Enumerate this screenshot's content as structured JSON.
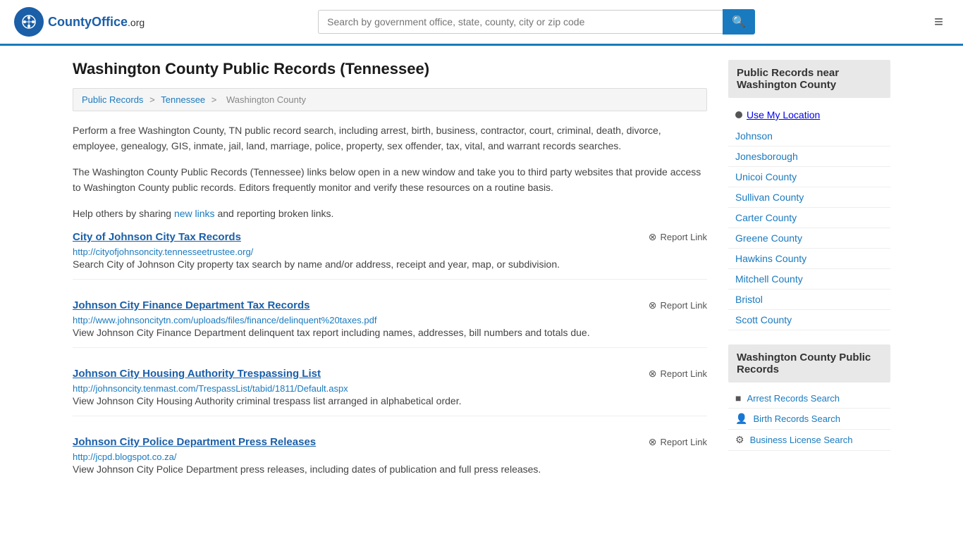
{
  "header": {
    "logo_text": "CountyOffice",
    "logo_suffix": ".org",
    "search_placeholder": "Search by government office, state, county, city or zip code",
    "search_icon": "🔍",
    "menu_icon": "≡"
  },
  "page": {
    "title": "Washington County Public Records (Tennessee)",
    "breadcrumb": {
      "items": [
        "Public Records",
        "Tennessee",
        "Washington County"
      ],
      "separators": [
        ">",
        ">"
      ]
    },
    "description1": "Perform a free Washington County, TN public record search, including arrest, birth, business, contractor, court, criminal, death, divorce, employee, genealogy, GIS, inmate, jail, land, marriage, police, property, sex offender, tax, vital, and warrant records searches.",
    "description2": "The Washington County Public Records (Tennessee) links below open in a new window and take you to third party websites that provide access to Washington County public records. Editors frequently monitor and verify these resources on a routine basis.",
    "description3_prefix": "Help others by sharing ",
    "description3_link": "new links",
    "description3_suffix": " and reporting broken links."
  },
  "records": [
    {
      "title": "City of Johnson City Tax Records",
      "url": "http://cityofjohnsoncity.tennesseetrustee.org/",
      "description": "Search City of Johnson City property tax search by name and/or address, receipt and year, map, or subdivision.",
      "report_label": "Report Link"
    },
    {
      "title": "Johnson City Finance Department Tax Records",
      "url": "http://www.johnsoncitytn.com/uploads/files/finance/delinquent%20taxes.pdf",
      "description": "View Johnson City Finance Department delinquent tax report including names, addresses, bill numbers and totals due.",
      "report_label": "Report Link"
    },
    {
      "title": "Johnson City Housing Authority Trespassing List",
      "url": "http://johnsoncity.tenmast.com/TrespassList/tabid/1811/Default.aspx",
      "description": "View Johnson City Housing Authority criminal trespass list arranged in alphabetical order.",
      "report_label": "Report Link"
    },
    {
      "title": "Johnson City Police Department Press Releases",
      "url": "http://jcpd.blogspot.co.za/",
      "description": "View Johnson City Police Department press releases, including dates of publication and full press releases.",
      "report_label": "Report Link"
    }
  ],
  "sidebar": {
    "nearby_header": "Public Records near Washington County",
    "use_location": "Use My Location",
    "nearby_places": [
      "Johnson",
      "Jonesborough",
      "Unicoi County",
      "Sullivan County",
      "Carter County",
      "Greene County",
      "Hawkins County",
      "Mitchell County",
      "Bristol",
      "Scott County"
    ],
    "records_header": "Washington County Public Records",
    "record_links": [
      {
        "icon": "■",
        "label": "Arrest Records Search"
      },
      {
        "icon": "👤",
        "label": "Birth Records Search"
      },
      {
        "icon": "⚙",
        "label": "Business License Search"
      }
    ]
  }
}
